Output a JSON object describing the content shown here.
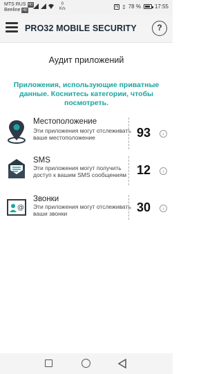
{
  "status_bar": {
    "carrier1": "MTS RUS",
    "carrier1_tag": "HD",
    "carrier2": "Beeline",
    "carrier2_tag": "HD",
    "net_speed_value": "0",
    "net_speed_unit": "K/s",
    "nfc": "N",
    "battery_percent": "78 %",
    "battery_level": 0.78,
    "time": "17:55"
  },
  "app_bar": {
    "logo": "PRO32 MOBILE SECURITY",
    "help": "?"
  },
  "page": {
    "title": "Аудит приложений",
    "subtitle": "Приложения, использующие приватные данные. Коснитесь категории, чтобы посмотреть."
  },
  "categories": [
    {
      "title": "Местоположение",
      "description": "Эти приложения могут отслеживать ваше местоположение",
      "count": "93",
      "icon": "location-pin-icon"
    },
    {
      "title": "SMS",
      "description": "Эти приложения могут получить доступ к вашим SMS сообщениям",
      "count": "12",
      "icon": "envelope-icon"
    },
    {
      "title": "Звонки",
      "description": "Эти приложения могут отслеживать ваши звонки",
      "count": "30",
      "icon": "contact-card-icon"
    }
  ],
  "colors": {
    "accent": "#1aa6a0",
    "icon_dark": "#2e3a46"
  }
}
